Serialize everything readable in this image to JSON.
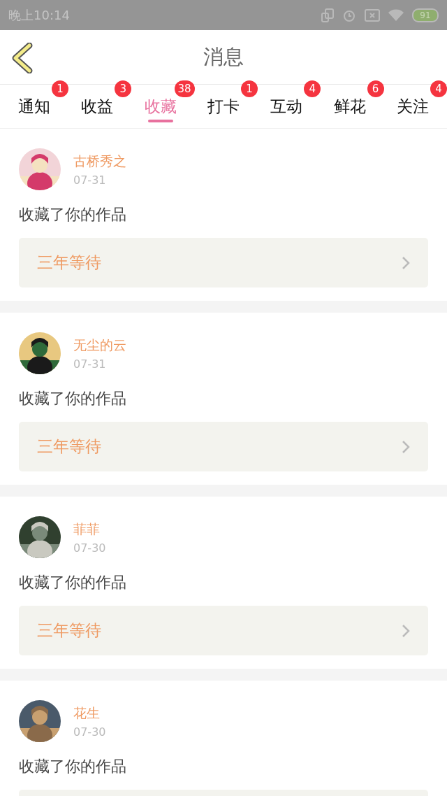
{
  "status_bar": {
    "time": "晚上10:14",
    "battery": "91"
  },
  "header": {
    "title": "消息"
  },
  "tabs": [
    {
      "label": "通知",
      "badge": "1",
      "selected": false
    },
    {
      "label": "收益",
      "badge": "3",
      "selected": false
    },
    {
      "label": "收藏",
      "badge": "38",
      "selected": true
    },
    {
      "label": "打卡",
      "badge": "1",
      "selected": false
    },
    {
      "label": "互动",
      "badge": "4",
      "selected": false
    },
    {
      "label": "鲜花",
      "badge": "6",
      "selected": false
    },
    {
      "label": "关注",
      "badge": "4",
      "selected": false
    }
  ],
  "messages": [
    {
      "name": "古桥秀之",
      "date": "07-31",
      "action": "收藏了你的作品",
      "work": "三年等待"
    },
    {
      "name": "无尘的云",
      "date": "07-31",
      "action": "收藏了你的作品",
      "work": "三年等待"
    },
    {
      "name": "菲菲",
      "date": "07-30",
      "action": "收藏了你的作品",
      "work": "三年等待"
    },
    {
      "name": "花生",
      "date": "07-30",
      "action": "收藏了你的作品"
    }
  ]
}
